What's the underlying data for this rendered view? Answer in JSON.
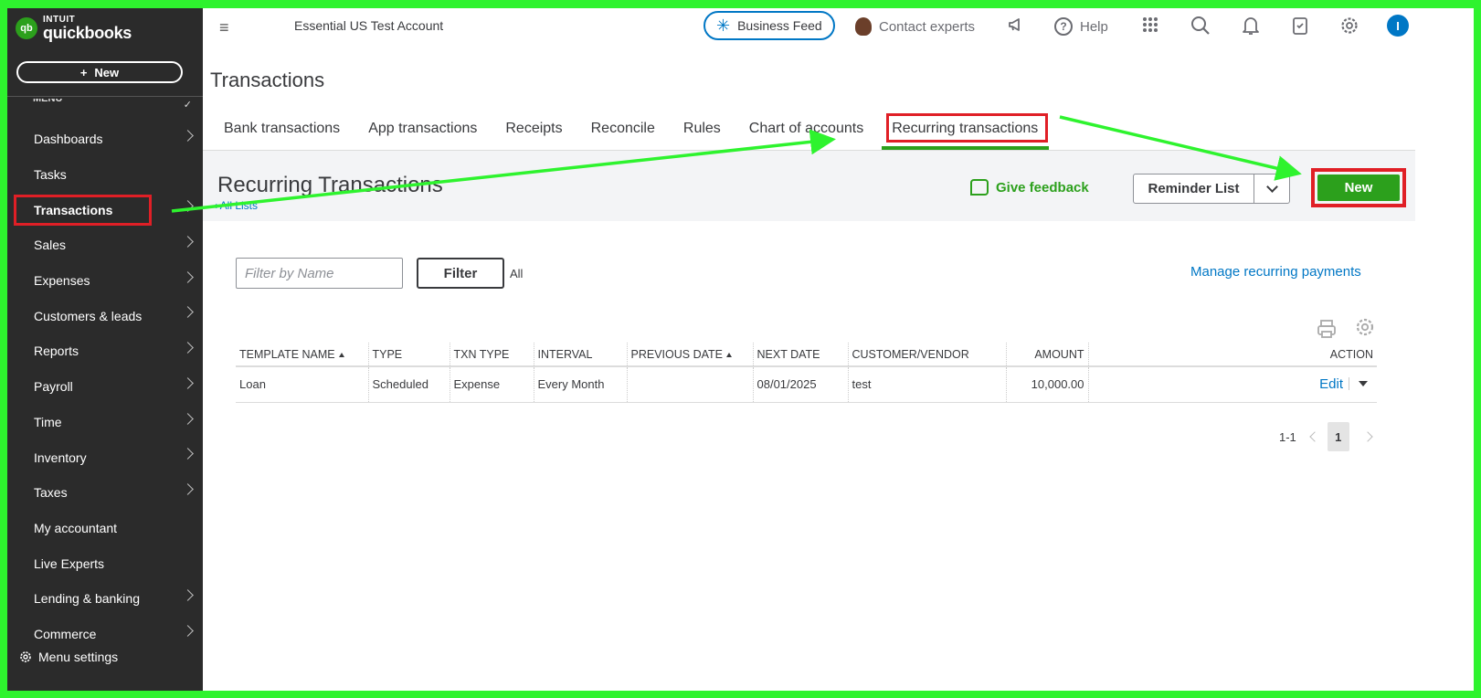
{
  "brand": {
    "line1": "INTUIT",
    "line2": "quickbooks",
    "mark": "qb"
  },
  "sidebar": {
    "new_label": "New",
    "menu_heading": "MENU",
    "items": [
      {
        "label": "Dashboards",
        "chevron": true
      },
      {
        "label": "Tasks",
        "chevron": false
      },
      {
        "label": "Transactions",
        "chevron": true,
        "active": true
      },
      {
        "label": "Sales",
        "chevron": true
      },
      {
        "label": "Expenses",
        "chevron": true
      },
      {
        "label": "Customers & leads",
        "chevron": true
      },
      {
        "label": "Reports",
        "chevron": true
      },
      {
        "label": "Payroll",
        "chevron": true
      },
      {
        "label": "Time",
        "chevron": true
      },
      {
        "label": "Inventory",
        "chevron": true
      },
      {
        "label": "Taxes",
        "chevron": true
      },
      {
        "label": "My accountant",
        "chevron": false
      },
      {
        "label": "Live Experts",
        "chevron": false
      },
      {
        "label": "Lending & banking",
        "chevron": true
      },
      {
        "label": "Commerce",
        "chevron": true
      }
    ],
    "menu_settings": "Menu settings"
  },
  "topbar": {
    "account_name": "Essential US Test Account",
    "business_feed": "Business Feed",
    "contact_experts": "Contact experts",
    "help": "Help",
    "user_initial": "I"
  },
  "page": {
    "title": "Transactions",
    "tabs": [
      "Bank transactions",
      "App transactions",
      "Receipts",
      "Reconcile",
      "Rules",
      "Chart of accounts",
      "Recurring transactions"
    ],
    "active_tab": 6
  },
  "recurring": {
    "title": "Recurring Transactions",
    "all_lists": "All Lists",
    "give_feedback": "Give feedback",
    "reminder_list": "Reminder List",
    "new_label": "New",
    "filter_placeholder": "Filter by Name",
    "filter_button": "Filter",
    "filter_all": "All",
    "manage_link": "Manage recurring payments"
  },
  "table": {
    "columns": [
      "TEMPLATE NAME",
      "TYPE",
      "TXN TYPE",
      "INTERVAL",
      "PREVIOUS DATE",
      "NEXT DATE",
      "CUSTOMER/VENDOR",
      "AMOUNT",
      "ACTION"
    ],
    "rows": [
      {
        "template_name": "Loan",
        "type": "Scheduled",
        "txn_type": "Expense",
        "interval": "Every Month",
        "previous_date": "",
        "next_date": "08/01/2025",
        "customer_vendor": "test",
        "amount": "10,000.00",
        "action": "Edit"
      }
    ]
  },
  "pagination": {
    "range": "1-1",
    "current_page": "1"
  },
  "colors": {
    "annotation_frame": "#2ef32e",
    "highlight_box": "#e01f26",
    "brand_green": "#2ca01c",
    "link_blue": "#0077c5",
    "sidebar_bg": "#2b2b2b"
  }
}
